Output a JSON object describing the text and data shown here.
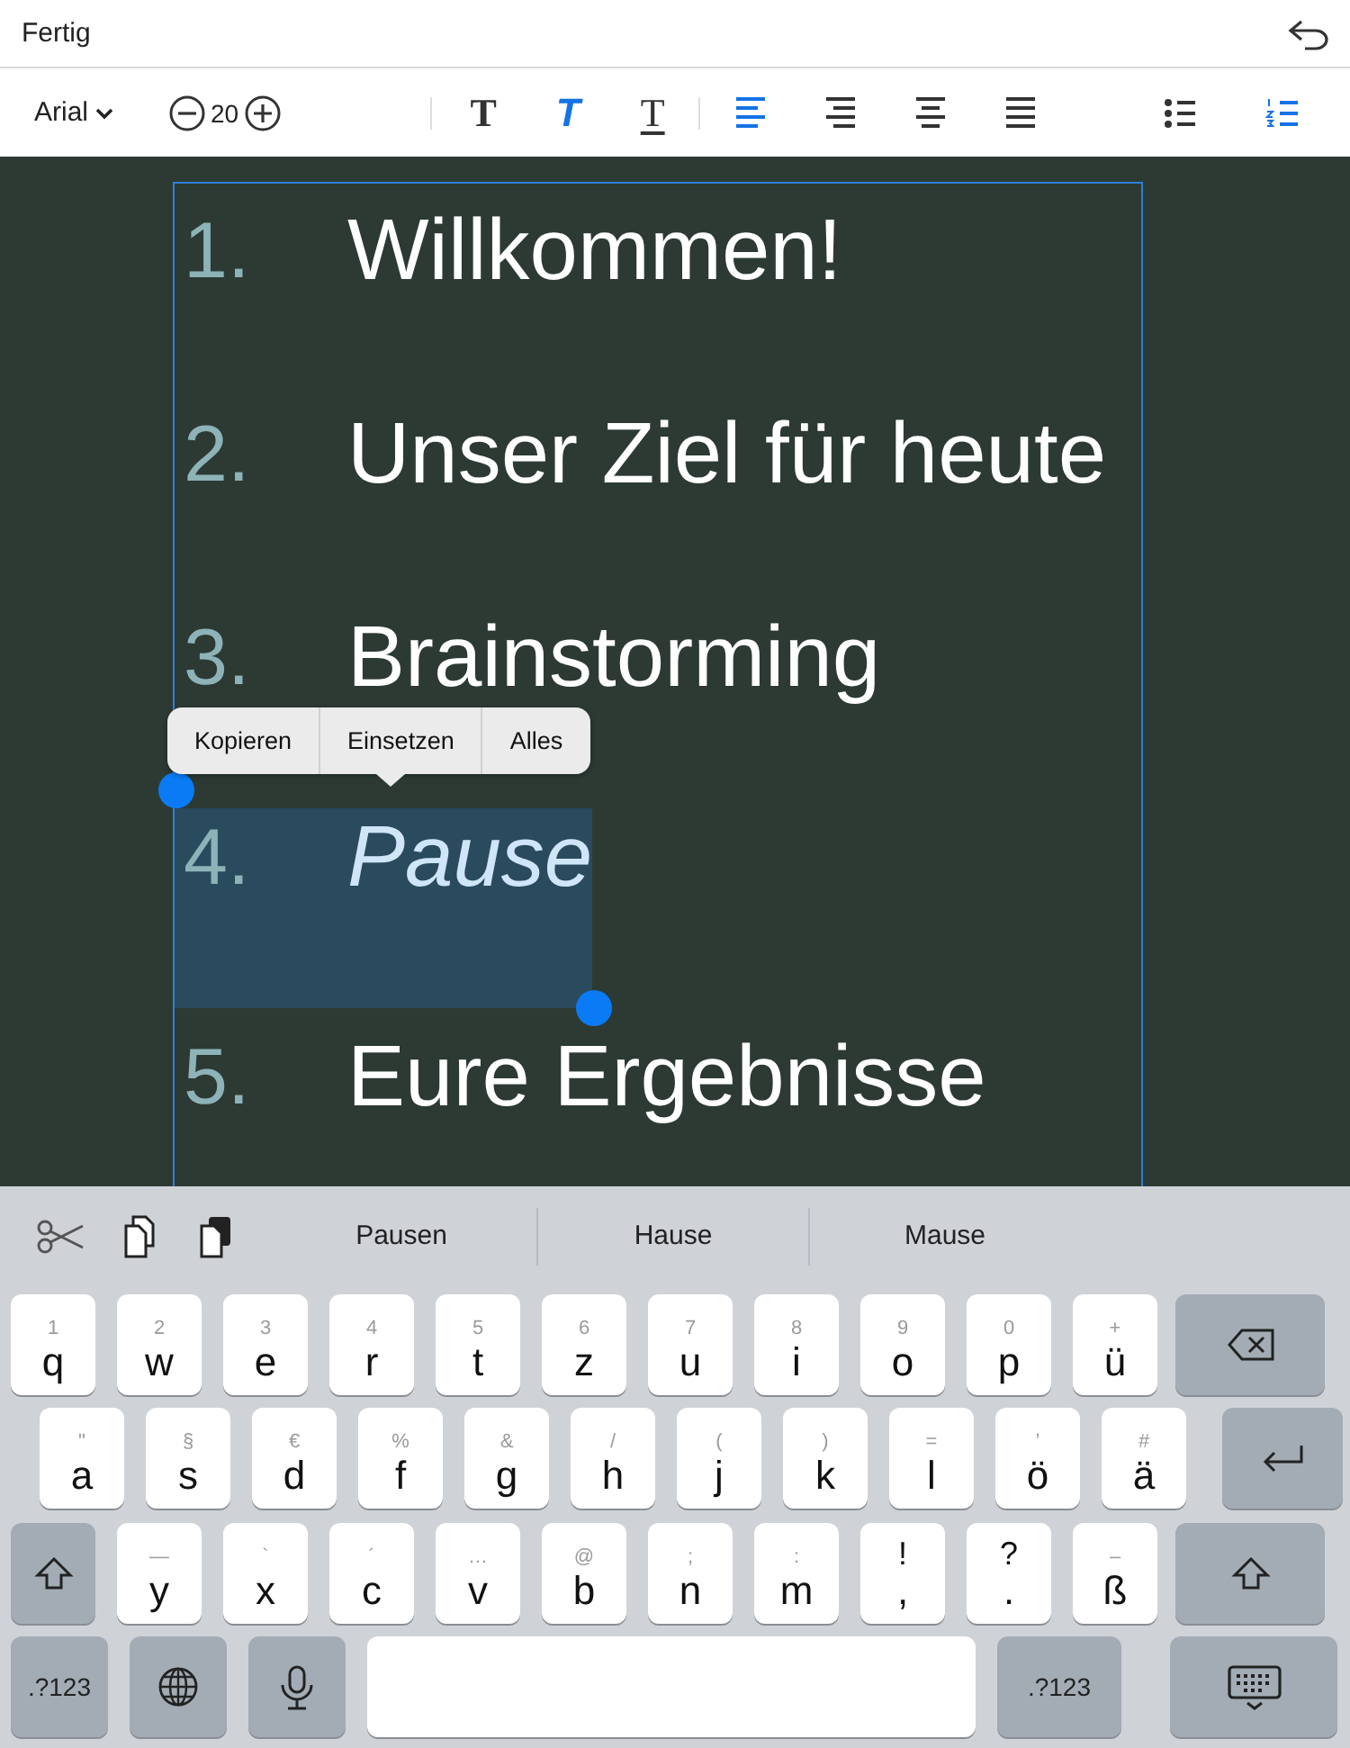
{
  "top_bar": {
    "done": "Fertig"
  },
  "toolbar": {
    "font": "Arial",
    "font_size": "20",
    "styles": [
      {
        "kind": "bold",
        "label": "T",
        "selected": false
      },
      {
        "kind": "italic",
        "label": "T",
        "selected": true
      },
      {
        "kind": "underline",
        "label": "T",
        "selected": false
      }
    ],
    "alignments": [
      {
        "kind": "left",
        "selected": true
      },
      {
        "kind": "right",
        "selected": false
      },
      {
        "kind": "center",
        "selected": false
      },
      {
        "kind": "justify",
        "selected": false
      }
    ],
    "lists": [
      {
        "kind": "bullet",
        "selected": false
      },
      {
        "kind": "numbered",
        "selected": true
      }
    ]
  },
  "slide": {
    "items": [
      {
        "number": "1.",
        "text": "Willkommen!",
        "italic": false,
        "selected": false
      },
      {
        "number": "2.",
        "text": "Unser Ziel für heute",
        "italic": false,
        "selected": false
      },
      {
        "number": "3.",
        "text": "Brainstorming",
        "italic": false,
        "selected": false
      },
      {
        "number": "4.",
        "text": "Pause",
        "italic": true,
        "selected": true
      },
      {
        "number": "5.",
        "text": "Eure Ergebnisse",
        "italic": false,
        "selected": false
      }
    ]
  },
  "context_menu": {
    "items": [
      "Kopieren",
      "Einsetzen",
      "Alles"
    ]
  },
  "keyboard": {
    "suggestions": [
      "Pausen",
      "Hause",
      "Mause"
    ],
    "rows": [
      [
        {
          "kind": "char",
          "hint": "1",
          "label": "q"
        },
        {
          "kind": "char",
          "hint": "2",
          "label": "w"
        },
        {
          "kind": "char",
          "hint": "3",
          "label": "e"
        },
        {
          "kind": "char",
          "hint": "4",
          "label": "r"
        },
        {
          "kind": "char",
          "hint": "5",
          "label": "t"
        },
        {
          "kind": "char",
          "hint": "6",
          "label": "z"
        },
        {
          "kind": "char",
          "hint": "7",
          "label": "u"
        },
        {
          "kind": "char",
          "hint": "8",
          "label": "i"
        },
        {
          "kind": "char",
          "hint": "9",
          "label": "o"
        },
        {
          "kind": "char",
          "hint": "0",
          "label": "p"
        },
        {
          "kind": "char",
          "hint": "+",
          "label": "ü"
        },
        {
          "kind": "backspace"
        }
      ],
      [
        {
          "kind": "char",
          "hint": "\"",
          "label": "a"
        },
        {
          "kind": "char",
          "hint": "§",
          "label": "s"
        },
        {
          "kind": "char",
          "hint": "€",
          "label": "d"
        },
        {
          "kind": "char",
          "hint": "%",
          "label": "f"
        },
        {
          "kind": "char",
          "hint": "&",
          "label": "g"
        },
        {
          "kind": "char",
          "hint": "/",
          "label": "h"
        },
        {
          "kind": "char",
          "hint": "(",
          "label": "j"
        },
        {
          "kind": "char",
          "hint": ")",
          "label": "k"
        },
        {
          "kind": "char",
          "hint": "=",
          "label": "l"
        },
        {
          "kind": "char",
          "hint": "’",
          "label": "ö"
        },
        {
          "kind": "char",
          "hint": "#",
          "label": "ä"
        },
        {
          "kind": "return"
        }
      ],
      [
        {
          "kind": "shift"
        },
        {
          "kind": "char",
          "hint": "—",
          "label": "y"
        },
        {
          "kind": "char",
          "hint": "`",
          "label": "x"
        },
        {
          "kind": "char",
          "hint": "´",
          "label": "c"
        },
        {
          "kind": "char",
          "hint": "…",
          "label": "v"
        },
        {
          "kind": "char",
          "hint": "@",
          "label": "b"
        },
        {
          "kind": "char",
          "hint": ";",
          "label": "n"
        },
        {
          "kind": "char",
          "hint": ":",
          "label": "m"
        },
        {
          "kind": "punct",
          "hint": "!",
          "label": ","
        },
        {
          "kind": "punct",
          "hint": "?",
          "label": "."
        },
        {
          "kind": "char",
          "hint": "–",
          "label": "ß"
        },
        {
          "kind": "shift"
        }
      ],
      [
        {
          "kind": "numbers",
          "label": ".?123"
        },
        {
          "kind": "globe"
        },
        {
          "kind": "mic"
        },
        {
          "kind": "space"
        },
        {
          "kind": "numbers",
          "label": ".?123"
        },
        {
          "kind": "hide"
        }
      ]
    ]
  }
}
